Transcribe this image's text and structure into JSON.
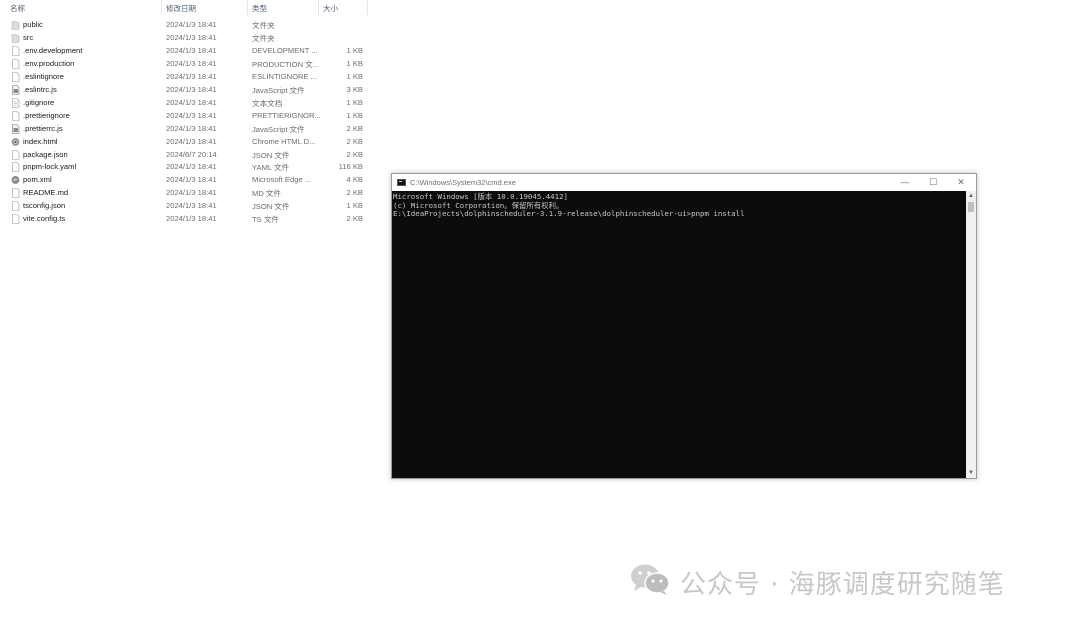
{
  "explorer": {
    "columns": {
      "name": "名称",
      "date": "修改日期",
      "type": "类型",
      "size": "大小"
    },
    "files": [
      {
        "name": "public",
        "date": "2024/1/3 18:41",
        "type": "文件夹",
        "size": "",
        "icon": "folder-icon"
      },
      {
        "name": "src",
        "date": "2024/1/3 18:41",
        "type": "文件夹",
        "size": "",
        "icon": "folder-icon"
      },
      {
        "name": ".env.development",
        "date": "2024/1/3 18:41",
        "type": "DEVELOPMENT ...",
        "size": "1 KB",
        "icon": "file-icon"
      },
      {
        "name": ".env.production",
        "date": "2024/1/3 18:41",
        "type": "PRODUCTION 文...",
        "size": "1 KB",
        "icon": "file-icon"
      },
      {
        "name": ".eslintignore",
        "date": "2024/1/3 18:41",
        "type": "ESLINTIGNORE ...",
        "size": "1 KB",
        "icon": "file-icon"
      },
      {
        "name": ".eslintrc.js",
        "date": "2024/1/3 18:41",
        "type": "JavaScript 文件",
        "size": "3 KB",
        "icon": "js-file-icon"
      },
      {
        "name": ".gitignore",
        "date": "2024/1/3 18:41",
        "type": "文本文档",
        "size": "1 KB",
        "icon": "text-file-icon"
      },
      {
        "name": ".prettierignore",
        "date": "2024/1/3 18:41",
        "type": "PRETTIERIGNOR...",
        "size": "1 KB",
        "icon": "file-icon"
      },
      {
        "name": ".prettierrc.js",
        "date": "2024/1/3 18:41",
        "type": "JavaScript 文件",
        "size": "2 KB",
        "icon": "js-file-icon"
      },
      {
        "name": "index.html",
        "date": "2024/1/3 18:41",
        "type": "Chrome HTML D...",
        "size": "2 KB",
        "icon": "chrome-icon"
      },
      {
        "name": "package.json",
        "date": "2024/6/7 20:14",
        "type": "JSON 文件",
        "size": "2 KB",
        "icon": "file-icon"
      },
      {
        "name": "pnpm-lock.yaml",
        "date": "2024/1/3 18:41",
        "type": "YAML 文件",
        "size": "116 KB",
        "icon": "file-icon"
      },
      {
        "name": "pom.xml",
        "date": "2024/1/3 18:41",
        "type": "Microsoft Edge ...",
        "size": "4 KB",
        "icon": "edge-icon"
      },
      {
        "name": "README.md",
        "date": "2024/1/3 18:41",
        "type": "MD 文件",
        "size": "2 KB",
        "icon": "file-icon"
      },
      {
        "name": "tsconfig.json",
        "date": "2024/1/3 18:41",
        "type": "JSON 文件",
        "size": "1 KB",
        "icon": "file-icon"
      },
      {
        "name": "vite.config.ts",
        "date": "2024/1/3 18:41",
        "type": "TS 文件",
        "size": "2 KB",
        "icon": "file-icon"
      }
    ]
  },
  "cmd": {
    "title": "C:\\Windows\\System32\\cmd.exe",
    "minimize_glyph": "—",
    "maximize_glyph": "☐",
    "close_glyph": "✕",
    "lines": [
      "Microsoft Windows [版本 10.0.19045.4412]",
      "(c) Microsoft Corporation。保留所有权利。",
      "",
      "E:\\IdeaProjects\\dolphinscheduler-3.1.9-release\\dolphinscheduler-ui>pnpm install"
    ]
  },
  "watermark": {
    "text": "公众号 · 海豚调度研究随笔",
    "icon": "wechat-icon"
  }
}
